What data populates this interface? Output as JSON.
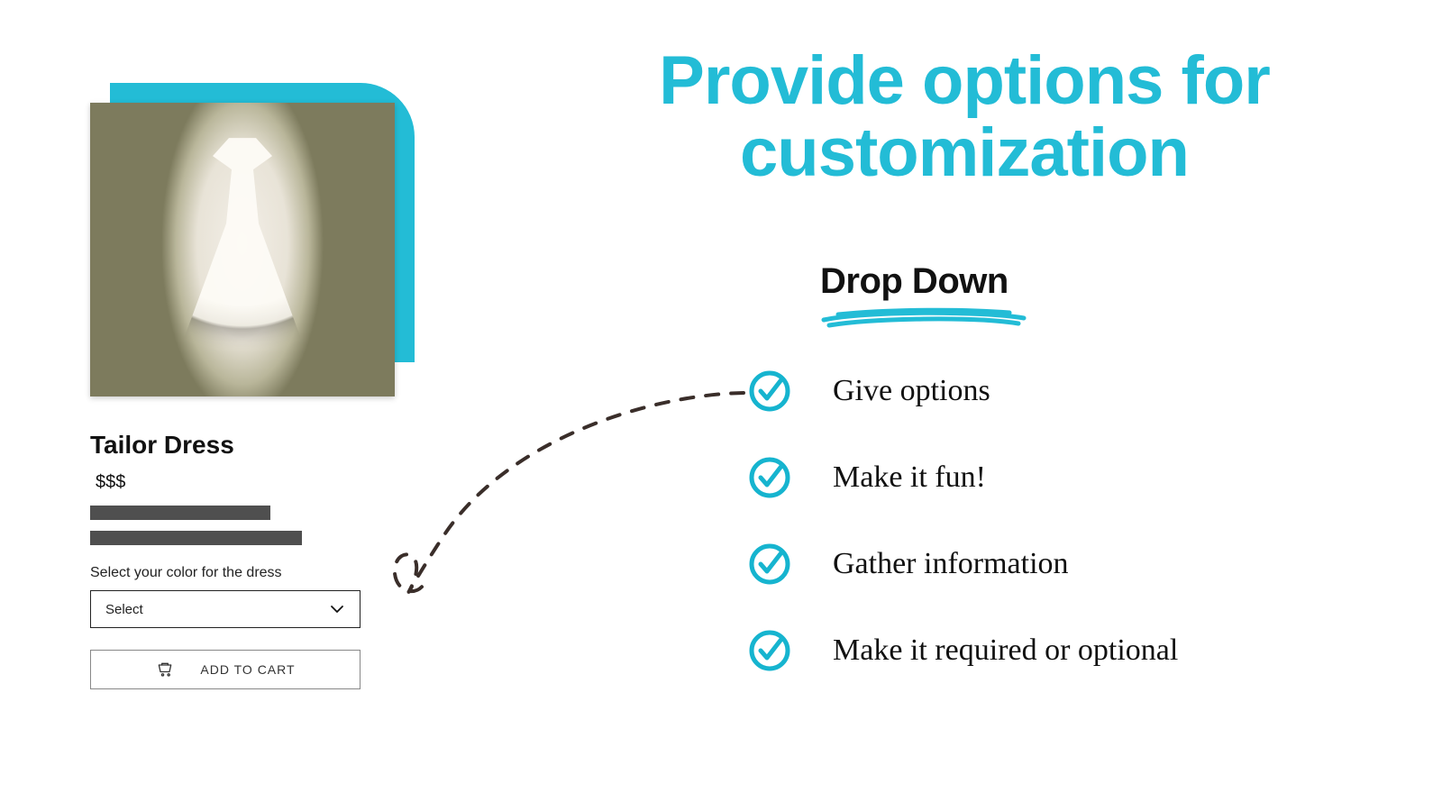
{
  "headline": "Provide options for customization",
  "subhead": "Drop Down",
  "bullets": [
    "Give options",
    "Make it fun!",
    "Gather information",
    "Make it required or optional"
  ],
  "product": {
    "title": "Tailor Dress",
    "price": "$$$",
    "option_label": "Select your color for the dress",
    "select_placeholder": "Select",
    "cta": "ADD TO CART"
  },
  "colors": {
    "accent": "#23bcd6"
  }
}
